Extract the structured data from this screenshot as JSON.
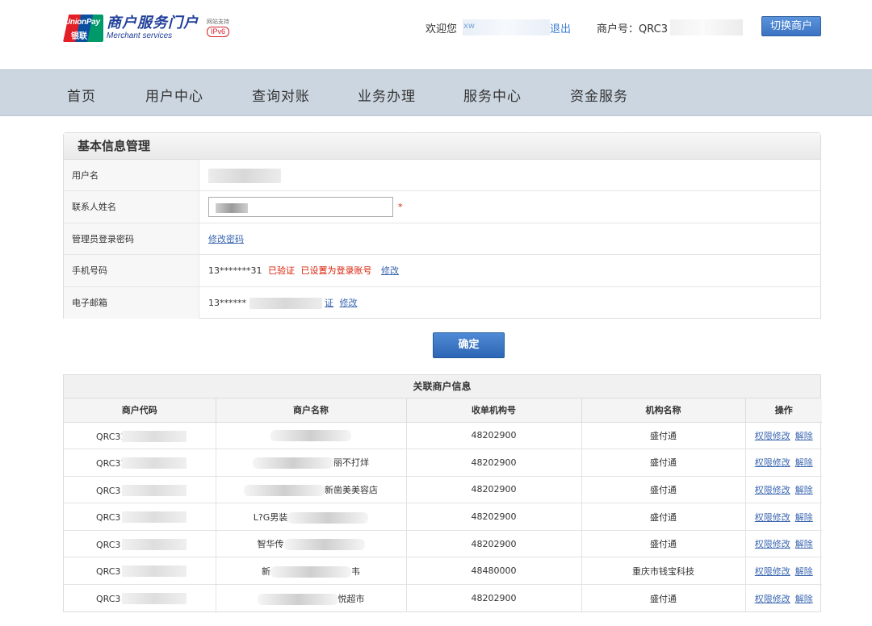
{
  "header": {
    "logo_unionpay": "UnionPay",
    "logo_cn_badge": "银联",
    "brand_cn": "商户服务门户",
    "brand_en": "Merchant services",
    "ipv6_caption": "网站支持",
    "ipv6_badge": "IPv6",
    "welcome": "欢迎您",
    "user_prefix": "xw",
    "logout": "退出",
    "merchant_no_label": "商户号：QRC3",
    "switch_merchant": "切换商户"
  },
  "nav": [
    "首页",
    "用户中心",
    "查询对账",
    "业务办理",
    "服务中心",
    "资金服务"
  ],
  "panel": {
    "title": "基本信息管理",
    "rows": {
      "username": {
        "label": "用户名"
      },
      "contact": {
        "label": "联系人姓名",
        "required": "*"
      },
      "password": {
        "label": "管理员登录密码",
        "link": "修改密码"
      },
      "phone": {
        "label": "手机号码",
        "value": "13*******31",
        "verified": "已验证",
        "login_set": "已设置为登录账号",
        "edit": "修改"
      },
      "email": {
        "label": "电子邮箱",
        "value": "13******",
        "verified_tail": "证",
        "edit": "修改"
      }
    }
  },
  "confirm_button": "确定",
  "related": {
    "title": "关联商户信息",
    "columns": [
      "商户代码",
      "商户名称",
      "收单机构号",
      "机构名称",
      "操作"
    ],
    "action_edit": "权限修改",
    "action_remove": "解除",
    "rows": [
      {
        "code": "QRC310",
        "name_prefix": "",
        "name_suffix": "",
        "acq": "48202900",
        "org": "盛付通"
      },
      {
        "code": "QRC31",
        "name_prefix": "",
        "name_suffix": "丽不打烊",
        "acq": "48202900",
        "org": "盛付通"
      },
      {
        "code": "QRC3",
        "name_prefix": "",
        "name_suffix": "新凿美美容店",
        "acq": "48202900",
        "org": "盛付通"
      },
      {
        "code": "QRC3",
        "name_prefix": "L?G男装",
        "name_suffix": "",
        "acq": "48202900",
        "org": "盛付通"
      },
      {
        "code": "QRC3",
        "name_prefix": "智华传",
        "name_suffix": "",
        "acq": "48202900",
        "org": "盛付通"
      },
      {
        "code": "QRC3",
        "name_prefix": "新",
        "name_suffix": "韦",
        "acq": "48480000",
        "org": "重庆市钱宝科技"
      },
      {
        "code": "QRC3",
        "name_prefix": "",
        "name_suffix": "悦超市",
        "acq": "48202900",
        "org": "盛付通"
      }
    ]
  }
}
